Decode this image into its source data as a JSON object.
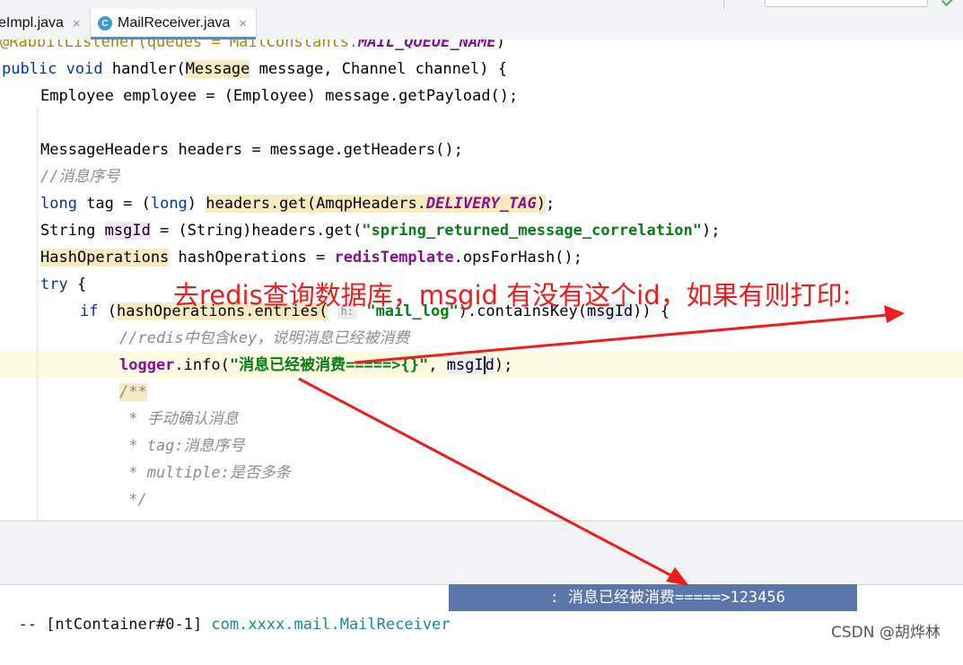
{
  "tabs": [
    {
      "label": "eImpl.java",
      "close": "×"
    },
    {
      "label": "MailReceiver.java",
      "icon_letter": "C",
      "close": "×"
    }
  ],
  "code": {
    "line0_anno": "@RabbitListener(queues = MailConstants.",
    "line0_const": "MAIL_QUEUE_NAME",
    "line0_end": ")",
    "l1_kw1": "public",
    "l1_kw2": "void",
    "l1_a": " handler(",
    "l1_type": "Message",
    "l1_b": " message, Channel channel) {",
    "l2": "Employee employee = (Employee) message.getPayload();",
    "l4": "MessageHeaders headers = message.getHeaders();",
    "l5_comment": "//消息序号",
    "l6_kw1": "long",
    "l6_a": " tag = (",
    "l6_kw2": "long",
    "l6_b": ") ",
    "l6_hl_a": "headers.get(AmqpHeaders.",
    "l6_hl_const": "DELIVERY_TAG",
    "l6_hl_b": ")",
    "l6_end": ";",
    "l7_a": "String ",
    "l7_var": "msgId",
    "l7_b": " = (String)headers.get(",
    "l7_str": "\"spring_returned_message_correlation\"",
    "l7_end": ");",
    "l8_type": "HashOperations",
    "l8_a": " hashOperations = ",
    "l8_field": "redisTemplate",
    "l8_b": ".opsForHash();",
    "l9_kw": "try",
    "l9_a": " {",
    "l10_kw": "if",
    "l10_a": " (",
    "l10_hl": "hashOperations.entries(",
    "l10_hint": "h:",
    "l10_str": "\"mail_log\"",
    "l10_b": ").containsKey(",
    "l10_var": "msgId",
    "l10_c": ")) {",
    "l11_comment": "//redis中包含key，说明消息已经被消费",
    "l12_field": "logger",
    "l12_a": ".info(",
    "l12_str": "\"消息已经被消费=====>{}\"",
    "l12_b": ", ",
    "l12_var1": "msgI",
    "l12_var2": "d",
    "l12_c": ");",
    "l13": "/**",
    "l14": " * 手动确认消息",
    "l15": " * tag:消息序号",
    "l16": " * multiple:是否多条",
    "l17": " */"
  },
  "console": {
    "prefix": "-- [ntContainer#0-1] ",
    "pkg": "com.xxxx.mail.MailReceive",
    "pkg_sel": "r",
    "message": "           : 消息已经被消费=====>123456"
  },
  "annotation": {
    "text": "去redis查询数据库，msgid 有没有这个id，如果有则打印:"
  },
  "watermark": "CSDN @胡烨林",
  "colors": {
    "keyword": "#0033b3",
    "string": "#067d17",
    "field": "#871094",
    "comment": "#8c8c8c",
    "annotation_red": "#ee1c1c",
    "selection": "#5b76a9"
  }
}
